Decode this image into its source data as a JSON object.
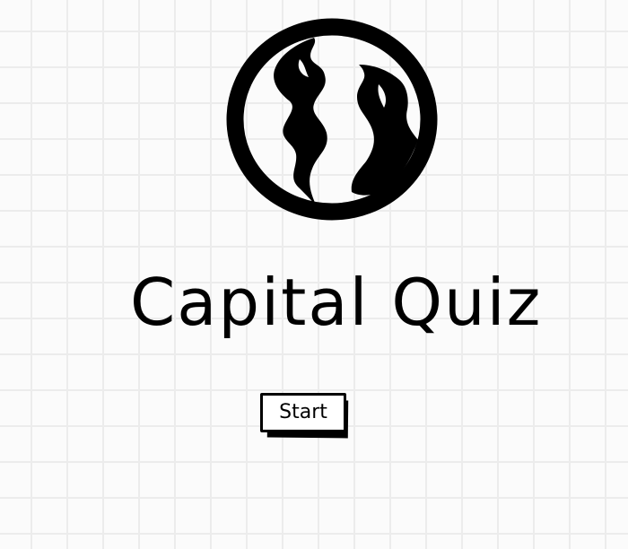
{
  "page": {
    "title": "Capital Quiz"
  },
  "logo": {
    "icon": "globe-icon",
    "color": "#000000"
  },
  "actions": {
    "start_label": "Start"
  },
  "theme": {
    "background": "#fbfbfb",
    "grid": "#ececec",
    "ink": "#000000"
  }
}
